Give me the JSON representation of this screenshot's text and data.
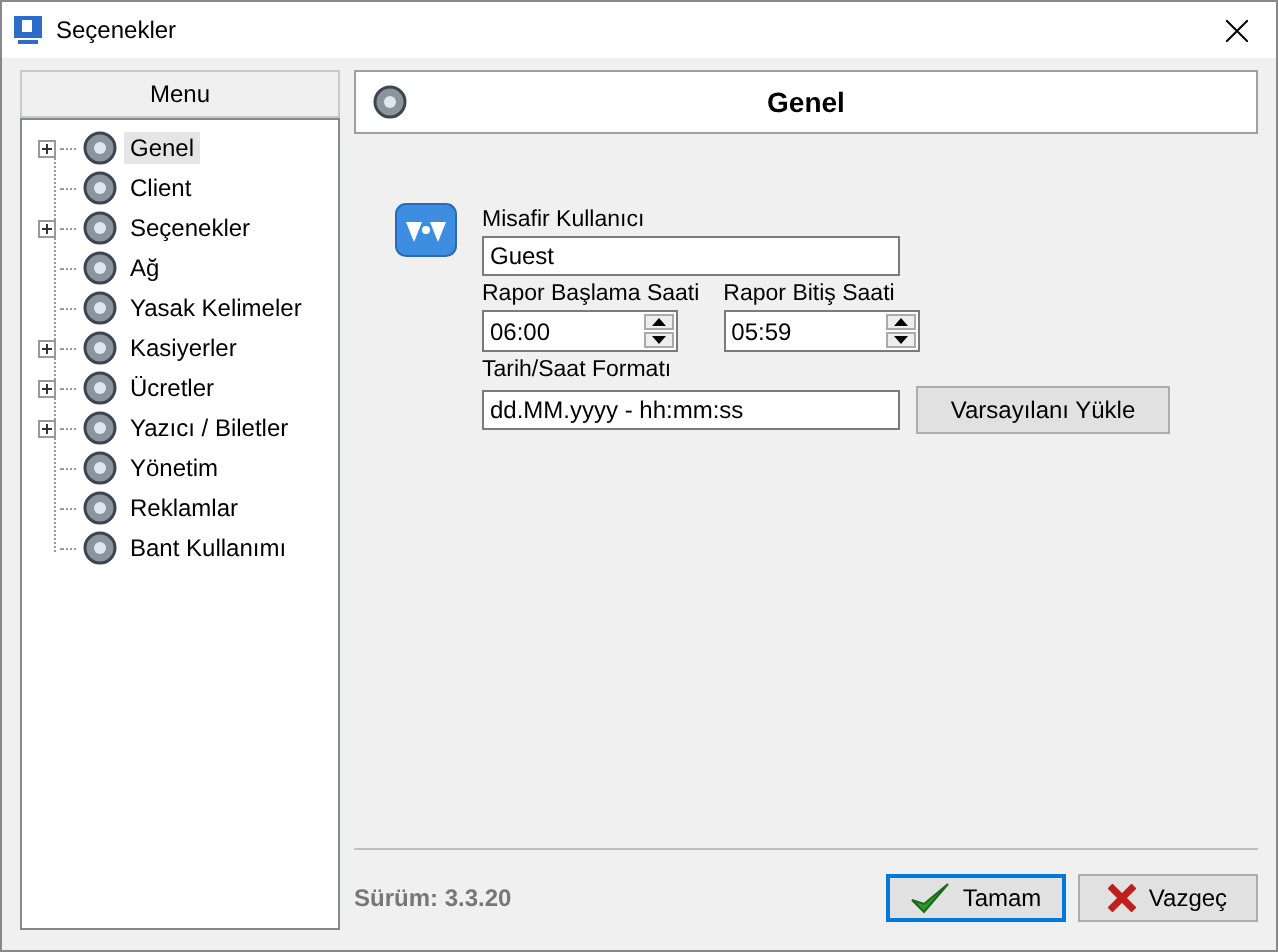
{
  "window": {
    "title": "Seçenekler"
  },
  "menu": {
    "title": "Menu",
    "items": [
      {
        "label": "Genel",
        "expandable": true,
        "selected": true
      },
      {
        "label": "Client",
        "expandable": false,
        "selected": false
      },
      {
        "label": "Seçenekler",
        "expandable": true,
        "selected": false
      },
      {
        "label": "Ağ",
        "expandable": false,
        "selected": false
      },
      {
        "label": "Yasak Kelimeler",
        "expandable": false,
        "selected": false
      },
      {
        "label": "Kasiyerler",
        "expandable": true,
        "selected": false
      },
      {
        "label": "Ücretler",
        "expandable": true,
        "selected": false
      },
      {
        "label": "Yazıcı / Biletler",
        "expandable": true,
        "selected": false
      },
      {
        "label": "Yönetim",
        "expandable": false,
        "selected": false
      },
      {
        "label": "Reklamlar",
        "expandable": false,
        "selected": false
      },
      {
        "label": "Bant Kullanımı",
        "expandable": false,
        "selected": false
      }
    ]
  },
  "panel": {
    "title": "Genel",
    "guest_user": {
      "label": "Misafir Kullanıcı",
      "value": "Guest"
    },
    "report_start": {
      "label": "Rapor Başlama Saati",
      "value": "06:00"
    },
    "report_end": {
      "label": "Rapor Bitiş Saati",
      "value": "05:59"
    },
    "date_format": {
      "label": "Tarih/Saat Formatı",
      "value": "dd.MM.yyyy - hh:mm:ss"
    },
    "load_defaults_button": "Varsayılanı Yükle"
  },
  "version": "Sürüm: 3.3.20",
  "buttons": [
    {
      "label": "Tamam",
      "kind": "ok",
      "focused": true
    },
    {
      "label": "Vazgeç",
      "kind": "cancel",
      "focused": false
    }
  ]
}
